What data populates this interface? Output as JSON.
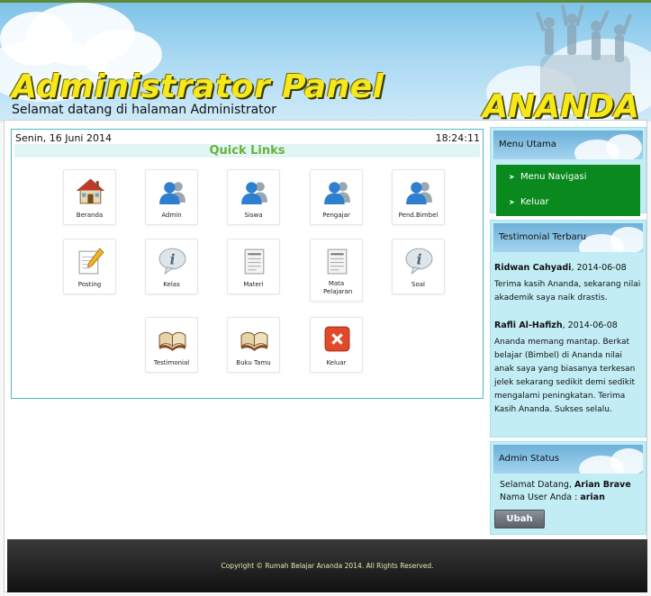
{
  "header": {
    "title": "Administrator Panel",
    "welcome": "Selamat datang di halaman Administrator",
    "brand": "ANANDA"
  },
  "content": {
    "date": "Senin, 16 Juni 2014",
    "time": "18:24:11",
    "quick_links_title": "Quick Links",
    "tiles": [
      {
        "label": "Beranda",
        "icon": "home-icon"
      },
      {
        "label": "Admin",
        "icon": "users-icon"
      },
      {
        "label": "Siswa",
        "icon": "users-icon"
      },
      {
        "label": "Pengajar",
        "icon": "users-icon"
      },
      {
        "label": "Pend.Bimbel",
        "icon": "users-icon"
      },
      {
        "label": "Posting",
        "icon": "edit-note-icon"
      },
      {
        "label": "Kelas",
        "icon": "info-bubble-icon"
      },
      {
        "label": "Materi",
        "icon": "document-icon"
      },
      {
        "label": "Mata Pelajaran",
        "icon": "document-icon"
      },
      {
        "label": "Soal",
        "icon": "info-bubble-icon"
      },
      {
        "label": "Testimonial",
        "icon": "book-icon"
      },
      {
        "label": "Buku Tamu",
        "icon": "book-icon"
      },
      {
        "label": "Keluar",
        "icon": "close-icon"
      }
    ]
  },
  "sidebar": {
    "menu": {
      "title": "Menu Utama",
      "items": [
        "Menu Navigasi",
        "Keluar"
      ]
    },
    "testimonials": {
      "title": "Testimonial Terbaru",
      "entries": [
        {
          "name": "Ridwan Cahyadi",
          "date": ", 2014-06-08",
          "text": "Terima kasih Ananda, sekarang nilai akademik saya naik drastis."
        },
        {
          "name": "Rafli Al-Hafizh",
          "date": ", 2014-06-08",
          "text": "Ananda memang mantap. Berkat belajar (Bimbel) di Ananda nilai anak saya yang biasanya terkesan jelek sekarang sedikit demi sedikit mengalami peningkatan. Terima Kasih Ananda. Sukses selalu."
        }
      ]
    },
    "status": {
      "title": "Admin Status",
      "greeting": "Selamat Datang, ",
      "user_display": "Arian Brave",
      "username_label": "Nama User Anda : ",
      "username": "arian",
      "button_label": "Ubah"
    }
  },
  "footer": {
    "copyright": "Copyright © Rumah Belajar Ananda 2014. All Rights Reserved."
  },
  "colors": {
    "title_yellow": "#f7e81c",
    "quick_links_green": "#66b43b",
    "menu_green": "#0a8a1e",
    "sidebar_bg": "#c2edf4",
    "content_border": "#4fb9c9"
  }
}
